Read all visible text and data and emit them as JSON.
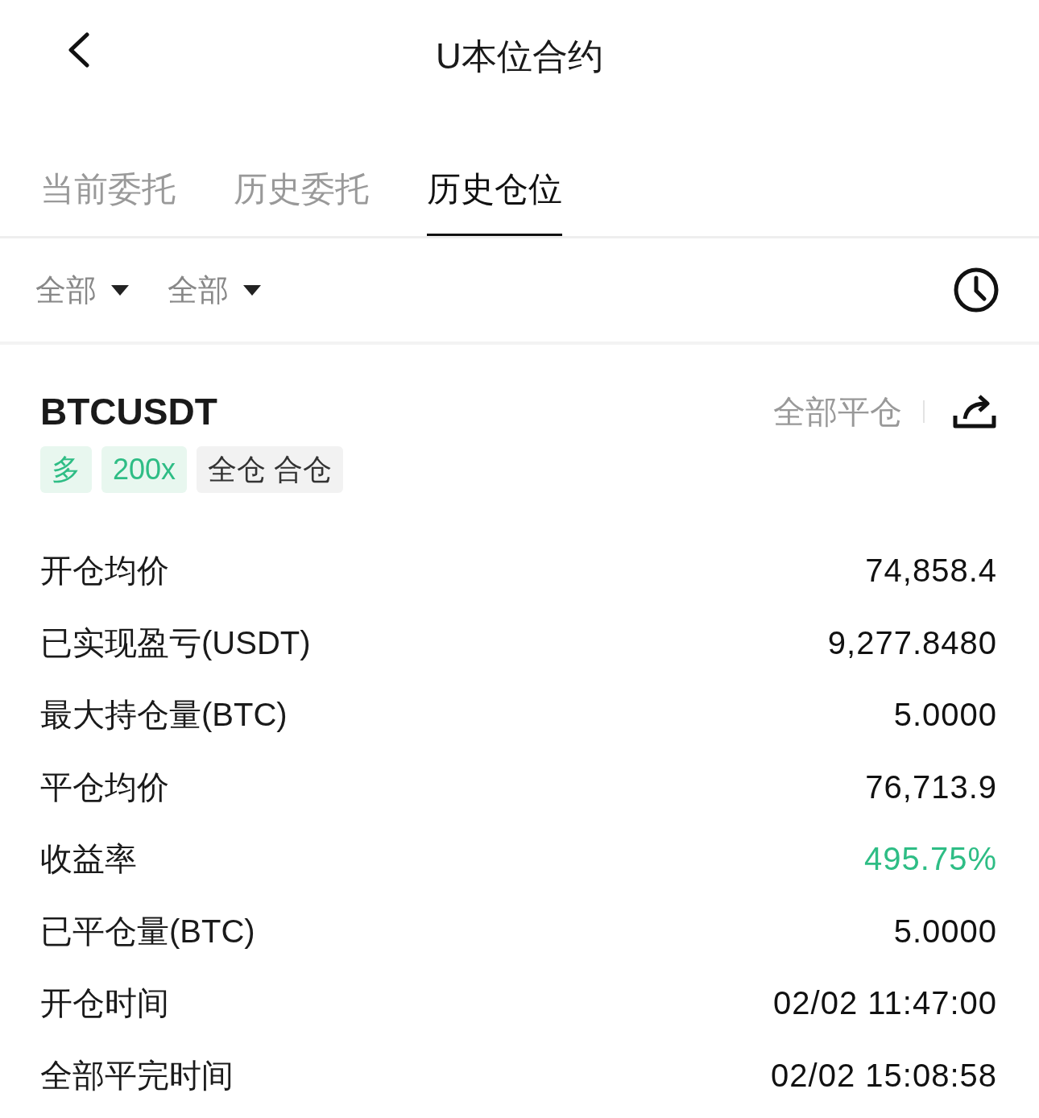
{
  "header": {
    "title": "U本位合约"
  },
  "tabs": [
    {
      "label": "当前委托",
      "selected": false
    },
    {
      "label": "历史委托",
      "selected": false
    },
    {
      "label": "历史仓位",
      "selected": true
    }
  ],
  "filters": [
    {
      "label": "全部"
    },
    {
      "label": "全部"
    }
  ],
  "position": {
    "symbol": "BTCUSDT",
    "close_all": "全部平仓",
    "tags": [
      {
        "text": "多",
        "kind": "long"
      },
      {
        "text": "200x",
        "kind": "long"
      },
      {
        "text": "全仓 合仓",
        "kind": "mode"
      }
    ],
    "rows": [
      {
        "label": "开仓均价",
        "value": "74,858.4",
        "kind": "plain"
      },
      {
        "label": "已实现盈亏(USDT)",
        "value": "9,277.8480",
        "kind": "plain"
      },
      {
        "label": "最大持仓量(BTC)",
        "value": "5.0000",
        "kind": "plain"
      },
      {
        "label": "平仓均价",
        "value": "76,713.9",
        "kind": "plain"
      },
      {
        "label": "收益率",
        "value": "495.75%",
        "kind": "gain"
      },
      {
        "label": "已平仓量(BTC)",
        "value": "5.0000",
        "kind": "plain"
      },
      {
        "label": "开仓时间",
        "value": "02/02 11:47:00",
        "kind": "plain"
      },
      {
        "label": "全部平完时间",
        "value": "02/02 15:08:58",
        "kind": "plain"
      }
    ]
  }
}
